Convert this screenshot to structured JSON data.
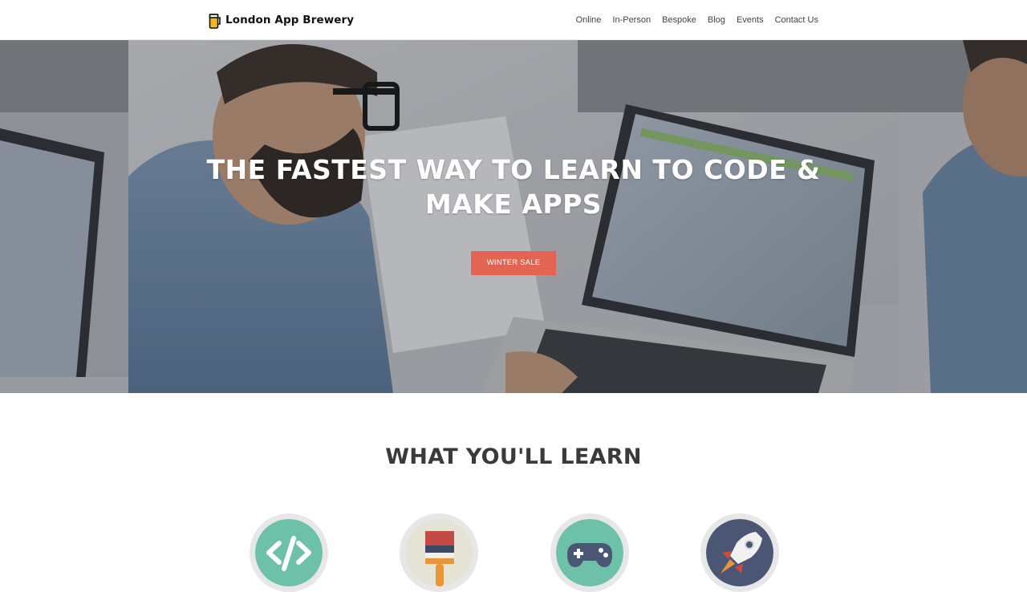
{
  "nav": {
    "brand": "London App Brewery",
    "links": [
      "Online",
      "In-Person",
      "Bespoke",
      "Blog",
      "Events",
      "Contact Us"
    ]
  },
  "hero": {
    "title_line1": "THE FASTEST WAY TO LEARN TO CODE &",
    "title_line2": "MAKE APPS",
    "cta": "WINTER SALE"
  },
  "learn": {
    "title": "WHAT YOU'LL LEARN",
    "icons": [
      "code-icon",
      "paint-brush-icon",
      "gamepad-icon",
      "rocket-icon"
    ]
  },
  "colors": {
    "cta": "#e46454",
    "code_bg": "#6ec1a9",
    "paint_bg": "#e5e3d5",
    "game_bg": "#6ec1a9",
    "rocket_bg": "#4a5674"
  }
}
